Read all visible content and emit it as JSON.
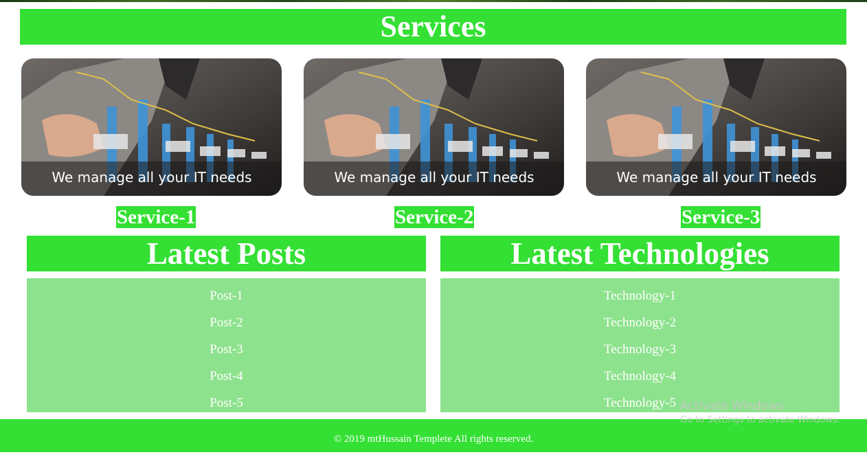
{
  "services": {
    "heading": "Services",
    "cards": [
      {
        "image_caption": "We manage all your IT needs",
        "label": "Service-1"
      },
      {
        "image_caption": "We manage all your IT needs",
        "label": "Service-2"
      },
      {
        "image_caption": "We manage all your IT needs",
        "label": "Service-3"
      }
    ]
  },
  "latest_posts": {
    "heading": "Latest Posts",
    "items": [
      "Post-1",
      "Post-2",
      "Post-3",
      "Post-4",
      "Post-5"
    ]
  },
  "latest_technologies": {
    "heading": "Latest Technologies",
    "items": [
      "Technology-1",
      "Technology-2",
      "Technology-3",
      "Technology-4",
      "Technology-5"
    ]
  },
  "footer": {
    "copyright": "© 2019 mtHussain Templete All rights reserved."
  },
  "watermark": {
    "title": "Activate Windows",
    "subtitle": "Go to Settings to activate Windows."
  },
  "colors": {
    "accent_green": "#33e033",
    "panel_green": "#8de28d"
  }
}
